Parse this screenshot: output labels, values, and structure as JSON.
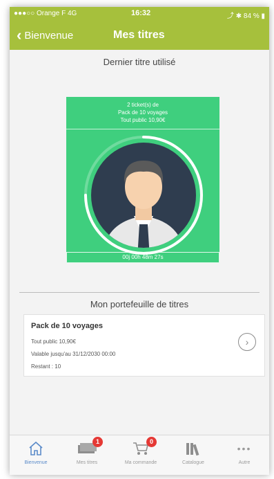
{
  "status_bar": {
    "carrier": "●●●○○ Orange F  4G",
    "time": "16:32",
    "battery": "⤴ ✱ 84 % ▮"
  },
  "nav": {
    "back_label": "Bienvenue",
    "title": "Mes titres"
  },
  "last_ticket": {
    "section_title": "Dernier titre utilisé",
    "line1": "2 ticket(s) de",
    "line2": "Pack de 10 voyages",
    "line3": "Tout public 10,90€",
    "timer": "00j 00h 48m 27s",
    "progress_fraction": 0.75
  },
  "wallet": {
    "section_title": "Mon portefeuille de titres",
    "item": {
      "name": "Pack de 10 voyages",
      "price": "Tout public 10,90€",
      "validity": "Valable jusqu'au 31/12/2030 00:00",
      "remaining": "Restant : 10"
    }
  },
  "tabs": [
    {
      "label": "Bienvenue",
      "icon": "home-icon",
      "badge": ""
    },
    {
      "label": "Mes titres",
      "icon": "ticket-icon",
      "badge": "1"
    },
    {
      "label": "Ma commande",
      "icon": "cart-icon",
      "badge": "0"
    },
    {
      "label": "Catalogue",
      "icon": "books-icon",
      "badge": ""
    },
    {
      "label": "Autre",
      "icon": "more-icon",
      "badge": ""
    }
  ],
  "colors": {
    "header": "#a6c03c",
    "ticket": "#3fcf7e",
    "badge": "#e53935",
    "active_tab": "#5b8bc9"
  }
}
